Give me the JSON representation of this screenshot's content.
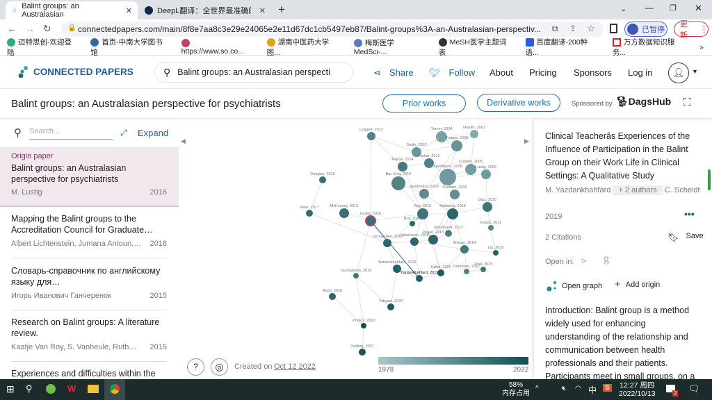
{
  "browser": {
    "tabs": [
      {
        "title": "Balint groups: an Australasian",
        "icon": "connected-papers-icon"
      },
      {
        "title": "DeepL翻译：全世界最准确的翻",
        "icon": "deepl-icon"
      }
    ],
    "url": "connectedpapers.com/main/8f8e7aa8c3e29e24065e2e11d67dc1cb5497eb87/Balint-groups%3A-an-Australasian-perspectiv...",
    "paused_label": "已暂停",
    "update_label": "更新",
    "bookmarks": [
      "迈特思创-欢迎登陆",
      "首页-中南大学图书馆",
      "https://www.so.co...",
      "湖南中医药大学图...",
      "梅斯医学MedSci-...",
      "MeSH医学主题词表",
      "百度翻译-200种语...",
      "万方数据知识服务..."
    ]
  },
  "site": {
    "logo": "CONNECTED PAPERS",
    "search_value": "Balint groups: an Australasian perspecti",
    "nav": {
      "share": "Share",
      "follow": "Follow",
      "about": "About",
      "pricing": "Pricing",
      "sponsors": "Sponsors",
      "login": "Log in"
    },
    "graph_title": "Balint groups: an Australasian perspective for psychiatrists",
    "prior_works": "Prior works",
    "derivative_works": "Derivative works",
    "sponsored_by": "Sponsored by",
    "sponsor": "DagsHub"
  },
  "list": {
    "search_placeholder": "Search...",
    "expand": "Expand",
    "origin_label": "Origin paper",
    "items": [
      {
        "title": "Balint groups: an Australasian perspective for psychiatrists",
        "authors": "M. Lustig",
        "year": "2016"
      },
      {
        "title": "Mapping the Balint groups to the Accreditation Council for Graduate…",
        "authors": "Albert Lichtenstein, Jumana Antoun,…",
        "year": "2018"
      },
      {
        "title": "Словарь-справочник по английскому языку для…",
        "authors": "Игорь Иванович Ганчеренок",
        "year": "2015"
      },
      {
        "title": "Research on Balint groups: A literature review.",
        "authors": "Kaatje Van Roy, S. Vanheule, Ruth…",
        "year": "2015"
      },
      {
        "title": "Experiences and difficulties within the",
        "authors": "",
        "year": ""
      }
    ]
  },
  "graph": {
    "created_label": "Created on",
    "created_date": "Oct 12 2022",
    "legend_min": "1978",
    "legend_max": "2022",
    "colors": {
      "old": "#a9c6c9",
      "new": "#0f4f55",
      "origin_ring": "#b0407a",
      "selected_edge": "#2a6fa0"
    },
    "nodes": [
      {
        "label": "Leggett, 2012",
        "year": 2012
      },
      {
        "label": "Turner, 2004",
        "year": 2004
      },
      {
        "label": "Horder, 2001",
        "year": 2001
      },
      {
        "label": "Torppa, 2008",
        "year": 2008
      },
      {
        "label": "Smith, 2007",
        "year": 2007
      },
      {
        "label": "Parker, 2012",
        "year": 2012
      },
      {
        "label": "Parker, 2014",
        "year": 2014
      },
      {
        "label": "Cataldo, 2005",
        "year": 2005
      },
      {
        "label": "Kjeldmand, 2008",
        "year": 2006
      },
      {
        "label": "Lustig, 2006",
        "year": 2006
      },
      {
        "label": "Bar-Sela, 2012",
        "year": 2012
      },
      {
        "label": "Douglas, 2016",
        "year": 2016
      },
      {
        "label": "Kjeldmand, 2010",
        "year": 2010
      },
      {
        "label": "Graham, 2009",
        "year": 2009
      },
      {
        "label": "Diaz, 2015",
        "year": 2015
      },
      {
        "label": "Elder, 2017",
        "year": 2017
      },
      {
        "label": "McKensey, 2016",
        "year": 2016
      },
      {
        "label": "Lustig, 2016",
        "year": 2016
      },
      {
        "label": "Roy, 2018",
        "year": 2018
      },
      {
        "label": "Roy, 2015",
        "year": 2015
      },
      {
        "label": "Mahoney, 2018",
        "year": 2018
      },
      {
        "label": "Evans, 2011",
        "year": 2011
      },
      {
        "label": "Kjeldmand, 2013",
        "year": 2013
      },
      {
        "label": "Player, 2018",
        "year": 2018
      },
      {
        "label": "Tschuschke, 2018",
        "year": 2018
      },
      {
        "label": "Johansson, 2018",
        "year": 2018
      },
      {
        "label": "Antoun, 2014",
        "year": 2014
      },
      {
        "label": "Liu, 2019",
        "year": 2019
      },
      {
        "label": "Yazdankhahfard, 2019",
        "year": 2019
      },
      {
        "label": "Salter, 2020",
        "year": 2020
      },
      {
        "label": "Unknown, 2012",
        "year": 2012
      },
      {
        "label": "Jinal, 2015",
        "year": 2015
      },
      {
        "label": "Yazdankhahfard, 2019",
        "year": 2019
      },
      {
        "label": "Ганчеренок, 2015",
        "year": 2015
      },
      {
        "label": "Anon, 2018",
        "year": 2018
      },
      {
        "label": "Yahyaei, 2020",
        "year": 2020
      },
      {
        "label": "Vinokur, 2022",
        "year": 2022
      },
      {
        "label": "Rydling, 2021",
        "year": 2021
      }
    ]
  },
  "detail": {
    "title": "Clinical Teacherâs Experiences of the Influence of Participation in the Balint Group on their Work Life in Clinical Settings: A Qualitative Study",
    "author1": "M. Yazdankhahfard",
    "more_authors": "+ 2 authors",
    "author2": "C. Scheidt",
    "year": "2019",
    "citations": "2 Citations",
    "save": "Save",
    "open_in": "Open in:",
    "open_graph": "Open graph",
    "add_origin": "Add origin",
    "abstract": "Introduction: Balint group is a method widely used for enhancing understanding of the relationship and communication between health professionals and their patients. Participants meet in small groups, on a"
  },
  "taskbar": {
    "memory_pct": "58%",
    "memory_label": "内存占用",
    "ime": "中",
    "time": "12:27 周四",
    "date": "2022/10/13",
    "badge": "2"
  }
}
